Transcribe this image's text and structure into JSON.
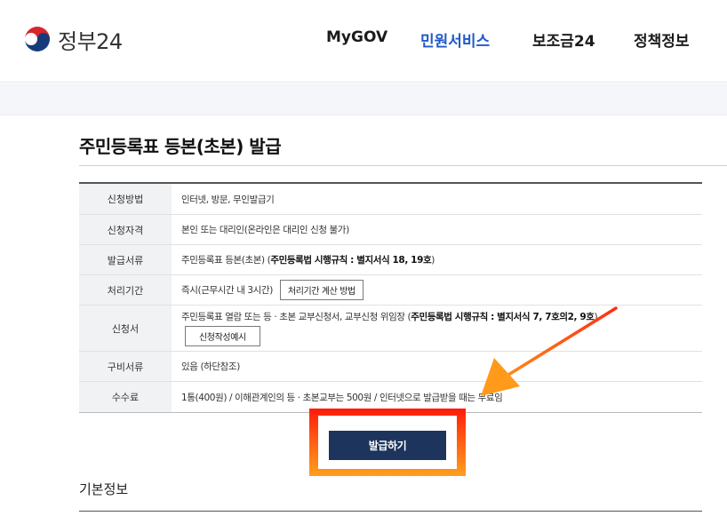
{
  "header": {
    "logo_text": "정부24",
    "nav": [
      {
        "label": "MyGOV",
        "active": false
      },
      {
        "label": "민원서비스",
        "active": true
      },
      {
        "label": "보조금24",
        "active": false
      },
      {
        "label": "정책정보",
        "active": false
      }
    ]
  },
  "page": {
    "title": "주민등록표 등본(초본) 발급"
  },
  "info": {
    "rows": [
      {
        "label": "신청방법",
        "value": "인터넷, 방문, 무인발급기"
      },
      {
        "label": "신청자격",
        "value": "본인 또는 대리인(온라인은 대리인 신청 불가)"
      },
      {
        "label": "발급서류",
        "value": "주민등록표 등본(초본) (",
        "bold": "주민등록법 시행규칙 : 별지서식 18, 19호",
        "suffix": ")"
      },
      {
        "label": "처리기간",
        "value": "즉시(근무시간 내 3시간)",
        "button": "처리기간 계산 방법"
      },
      {
        "label": "신청서",
        "value": "주민등록표 열람 또는 등 · 초본 교부신청서, 교부신청 위임장 (",
        "bold": "주민등록법 시행규칙 : 별지서식 7, 7호의2, 9호",
        "suffix": ")",
        "button": "신청작성예시"
      },
      {
        "label": "구비서류",
        "value": "있음 (하단참조)"
      },
      {
        "label": "수수료",
        "value": "1통(400원) / 이해관계인의 등 · 초본교부는 500원 / 인터넷으로 발급받을 때는 무료임"
      }
    ]
  },
  "actions": {
    "issue_label": "발급하기"
  },
  "sections": {
    "basic_info": "기본정보"
  },
  "colors": {
    "nav_active": "#1f5ac9",
    "primary_button": "#1d355c",
    "highlight_box": "#ff3a10",
    "arrow": "#ff8a00"
  }
}
